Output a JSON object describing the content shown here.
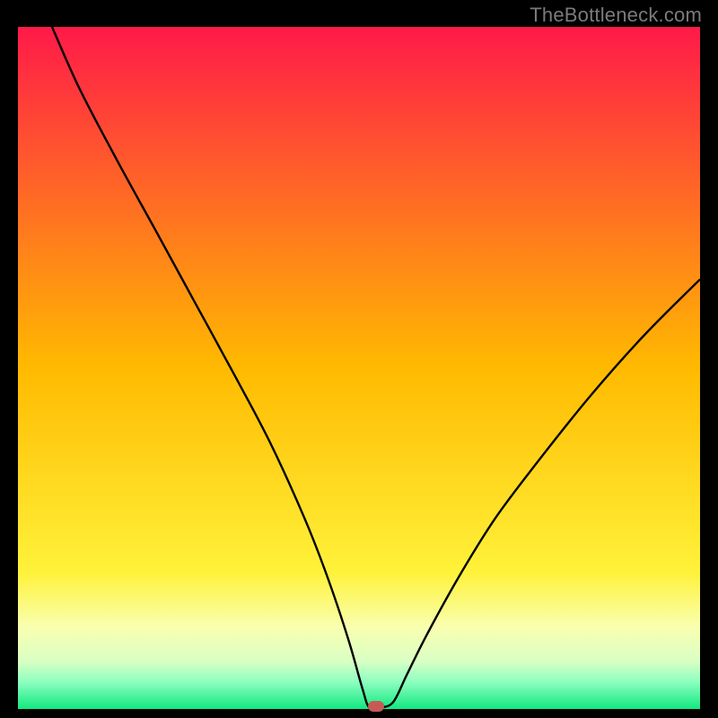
{
  "watermark": "TheBottleneck.com",
  "chart_data": {
    "type": "line",
    "title": "",
    "xlabel": "",
    "ylabel": "",
    "xlim": [
      0,
      100
    ],
    "ylim": [
      0,
      100
    ],
    "background_gradient": {
      "stops": [
        {
          "offset": 0.0,
          "color": "#ff1a49"
        },
        {
          "offset": 0.5,
          "color": "#ffba00"
        },
        {
          "offset": 0.8,
          "color": "#fff23a"
        },
        {
          "offset": 0.88,
          "color": "#f9ffb0"
        },
        {
          "offset": 0.93,
          "color": "#d9ffc4"
        },
        {
          "offset": 0.96,
          "color": "#8dffc0"
        },
        {
          "offset": 1.0,
          "color": "#12e880"
        }
      ]
    },
    "series": [
      {
        "name": "bottleneck-curve",
        "color": "#000000",
        "x": [
          5.0,
          9.0,
          14.5,
          20.0,
          26.0,
          32.0,
          37.0,
          42.0,
          45.5,
          48.5,
          50.5,
          51.5,
          53.0,
          55.0,
          57.0,
          60.0,
          65.0,
          70.0,
          76.0,
          84.0,
          92.0,
          100.0
        ],
        "y": [
          100.0,
          91.0,
          80.5,
          70.5,
          59.5,
          48.5,
          39.0,
          28.0,
          19.0,
          10.0,
          3.0,
          0.2,
          0.2,
          1.0,
          5.0,
          11.0,
          20.0,
          28.0,
          36.0,
          46.0,
          55.0,
          63.0
        ]
      }
    ],
    "marker": {
      "x": 52.5,
      "y": 0.4,
      "color": "#c65a57"
    }
  }
}
